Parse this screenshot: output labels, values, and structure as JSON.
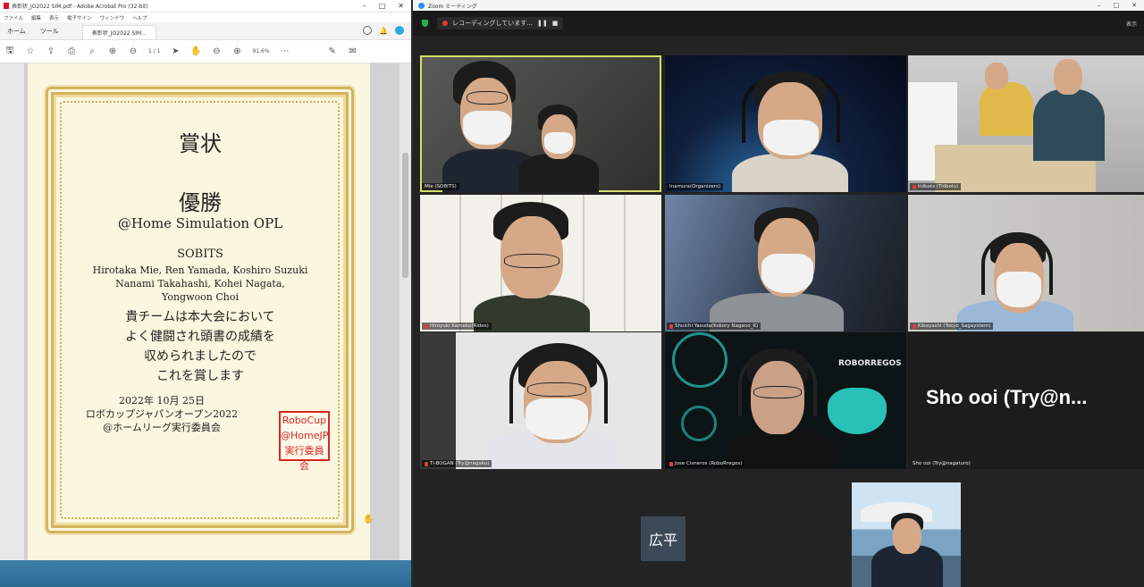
{
  "acrobat": {
    "title": "表彰状_JO2022 SIM.pdf - Adobe Acrobat Pro (32-bit)",
    "menu": [
      "ファイル",
      "編集",
      "表示",
      "電子サイン",
      "ウィンドウ",
      "ヘルプ"
    ],
    "tabs": {
      "home": "ホーム",
      "tools": "ツール",
      "doc": "表彰状_JO2022 SIM..."
    },
    "page_indicator": "1 / 1",
    "zoom_level": "91.6%"
  },
  "certificate": {
    "title": "賞状",
    "award": "優勝",
    "event": "@Home Simulation OPL",
    "team": "SOBITS",
    "members": [
      "Hirotaka Mie, Ren Yamada, Koshiro Suzuki",
      "Nanami Takahashi, Kohei Nagata,",
      "Yongwoon Choi"
    ],
    "body": [
      "貴チームは本大会において",
      "よく健闘され頭書の成績を",
      "収められましたので",
      "これを賞します"
    ],
    "date": "2022年 10月 25日",
    "org1": "ロボカップジャパンオープン2022",
    "org2": "@ホームリーグ実行委員会",
    "stamp": [
      "RoboCup",
      "@HomeJP",
      "実行委員会"
    ]
  },
  "zoom": {
    "title": "Zoom ミーティング",
    "recording": "レコーディングしています...",
    "view": "表示",
    "tiles": [
      {
        "name": "Mie (SOBITS)"
      },
      {
        "name": "Inamura(Organizers)"
      },
      {
        "name": "tidbots (Tidbots)"
      },
      {
        "name": "Hiroyuki Kameko(Rides)"
      },
      {
        "name": "Shuichi Yasuda(Kokory Nagano_K)"
      },
      {
        "name": "Kibayashi (Tokyo_Sagaystem)"
      },
      {
        "name": "Ti-BOGAN (Try@nagaku)"
      },
      {
        "name": "Jose Cisneros (RoboRregos)"
      },
      {
        "name": "Sho ooi (Try@nagaturo)"
      }
    ],
    "big_name": "Sho ooi (Try@n...",
    "initial_box": "広平",
    "roborregos": "ROBORREGOS"
  }
}
